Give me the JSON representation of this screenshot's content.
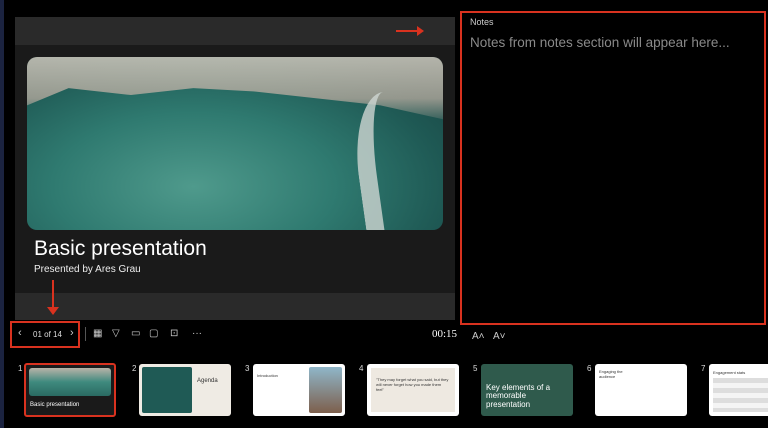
{
  "slide": {
    "title": "Basic presentation",
    "subtitle": "Presented by Ares Grau"
  },
  "notes": {
    "header": "Notes",
    "placeholder": "Notes from notes section will appear here..."
  },
  "toolbar": {
    "prev_icon": "chevron-left-icon",
    "counter": "01 of 14",
    "next_icon": "chevron-right-icon",
    "timer": "00:15",
    "font_increase": "A˄",
    "font_decrease": "A˅",
    "more": "···"
  },
  "thumbnails": [
    {
      "num": "1",
      "title": "Basic presentation",
      "selected": true
    },
    {
      "num": "2",
      "title": "Agenda"
    },
    {
      "num": "3",
      "title": "Introduction"
    },
    {
      "num": "4",
      "title": "\"They may forget what you said, but they will never forget how you made them feel\""
    },
    {
      "num": "5",
      "title": "Key elements of a memorable presentation"
    },
    {
      "num": "6",
      "title": "Engaging the audience"
    },
    {
      "num": "7",
      "title": "Engagement stats"
    }
  ],
  "colors": {
    "accent": "#d9321f",
    "slide5": "#2f5a4c"
  }
}
